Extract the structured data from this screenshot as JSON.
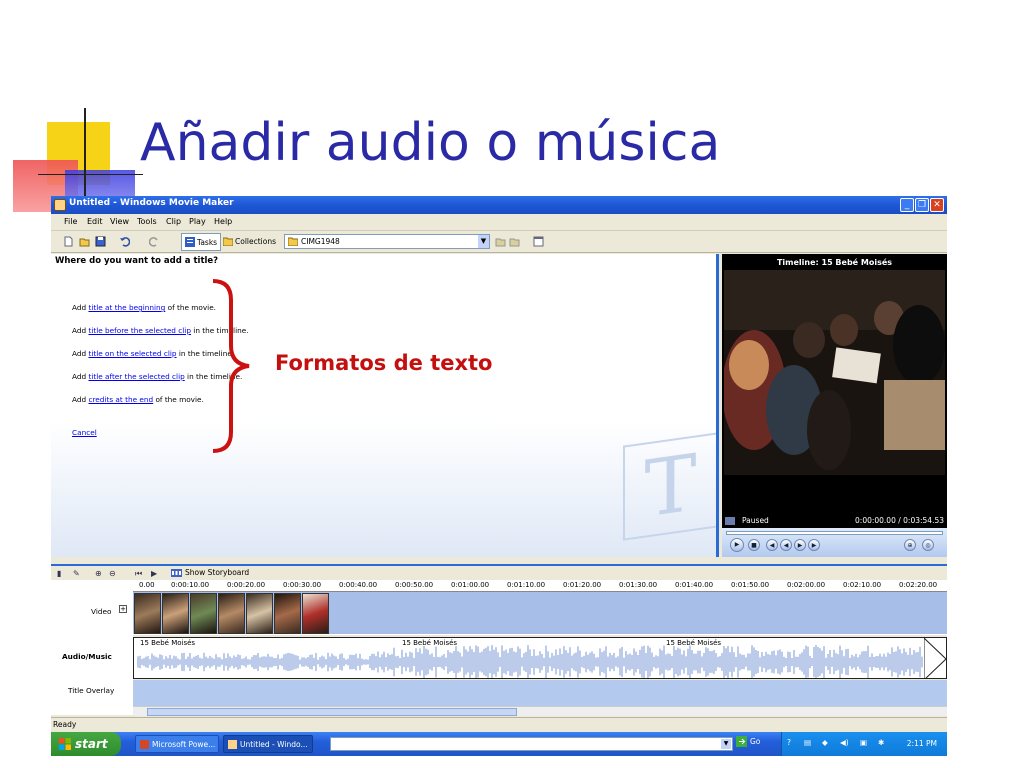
{
  "slide": {
    "title": "Añadir audio o música"
  },
  "window": {
    "title": "Untitled - Windows Movie Maker",
    "controls": {
      "minimize": "_",
      "maximize": "❐",
      "close": "✕"
    }
  },
  "menu": [
    "File",
    "Edit",
    "View",
    "Tools",
    "Clip",
    "Play",
    "Help"
  ],
  "toolbar": {
    "tasks_label": "Tasks",
    "collections_label": "Collections",
    "collection_value": "CIMG1948"
  },
  "taskpane": {
    "heading": "Where do you want to add a title?",
    "items": [
      {
        "pre": "Add ",
        "link": "title at the beginning",
        "post": " of the movie."
      },
      {
        "pre": "Add ",
        "link": "title before the selected clip",
        "post": " in the timeline."
      },
      {
        "pre": "Add ",
        "link": "title on the selected clip",
        "post": " in the timeline."
      },
      {
        "pre": "Add ",
        "link": "title after the selected clip",
        "post": " in the timeline."
      },
      {
        "pre": "Add ",
        "link": "credits at the end",
        "post": " of the movie."
      }
    ],
    "cancel": "Cancel",
    "watermark_letter": "T"
  },
  "preview": {
    "title": "Timeline: 15 Bebé Moisés",
    "state": "Paused",
    "time": "0:00:00.00 / 0:03:54.53",
    "progress": 0
  },
  "timeline": {
    "show_storyboard": "Show Storyboard",
    "ruler": [
      "0.00",
      "0:00:10.00",
      "0:00:20.00",
      "0:00:30.00",
      "0:00:40.00",
      "0:00:50.00",
      "0:01:00.00",
      "0:01:10.00",
      "0:01:20.00",
      "0:01:30.00",
      "0:01:40.00",
      "0:01:50.00",
      "0:02:00.00",
      "0:02:10.00",
      "0:02:20.00"
    ],
    "tracks": {
      "video": "Video",
      "audio": "Audio/Music",
      "overlay": "Title Overlay"
    },
    "audio_clips": [
      "15 Bebé Moisés",
      "15 Bebé Moisés",
      "15 Bebé Moisés"
    ]
  },
  "status": "Ready",
  "taskbar": {
    "start": "start",
    "items": [
      "Microsoft Powe...",
      "Untitled - Windo..."
    ],
    "go": "Go",
    "clock": "2:11 PM"
  },
  "annotation": {
    "label": "Formatos de texto",
    "color": "#c40f0f"
  }
}
